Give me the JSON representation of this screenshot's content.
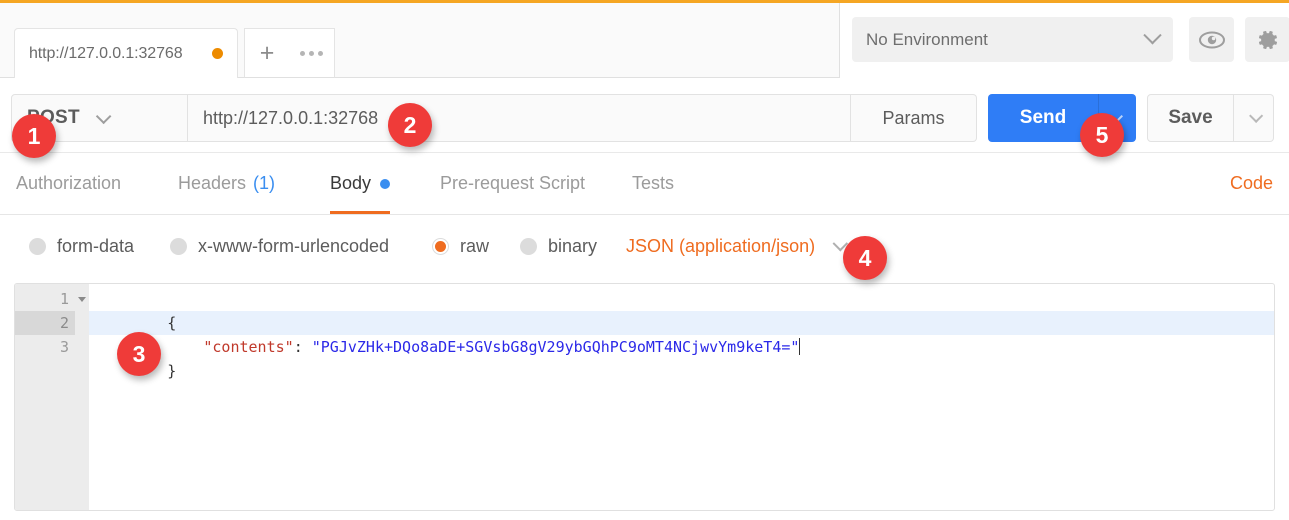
{
  "window": {
    "accent_color": "#f5a623",
    "primary_color": "#2f7df6",
    "marker_color": "#ef3b39",
    "orange_color": "#ef6c20"
  },
  "tabstrip": {
    "request_tab_label": "http://127.0.0.1:32768",
    "unsaved_indicator": "unsaved-dot",
    "new_tab_label": "+",
    "more_label": "more-icon"
  },
  "environment": {
    "selected": "No Environment",
    "chevron": "chevron-down-icon",
    "eye_icon": "eye-icon",
    "gear_icon": "gear-icon"
  },
  "url_row": {
    "method": "POST",
    "url": "http://127.0.0.1:32768",
    "params_label": "Params",
    "send_label": "Send",
    "save_label": "Save"
  },
  "nav_tabs": [
    {
      "label": "Authorization",
      "active": false
    },
    {
      "label": "Headers",
      "count": "(1)",
      "active": false
    },
    {
      "label": "Body",
      "active": true
    },
    {
      "label": "Pre-request Script",
      "active": false
    },
    {
      "label": "Tests",
      "active": false
    }
  ],
  "code_link": "Code",
  "body_types": [
    {
      "label": "form-data",
      "selected": false
    },
    {
      "label": "x-www-form-urlencoded",
      "selected": false
    },
    {
      "label": "raw",
      "selected": true
    },
    {
      "label": "binary",
      "selected": false
    }
  ],
  "content_type": "JSON (application/json)",
  "editor": {
    "lines": [
      {
        "number": "1",
        "foldable": true,
        "current": false
      },
      {
        "number": "2",
        "foldable": false,
        "current": true
      },
      {
        "number": "3",
        "foldable": false,
        "current": false
      }
    ],
    "line1": "{",
    "line2_indent": "    ",
    "line2_key": "\"contents\"",
    "line2_colon": ": ",
    "line2_value": "\"PGJvZHk+DQo8aDE+SGVsbG8gV29ybGQhPC9oMT4NCjwvYm9keT4=\"",
    "line3": "}"
  },
  "markers": {
    "m1": "1",
    "m2": "2",
    "m3": "3",
    "m4": "4",
    "m5": "5"
  }
}
